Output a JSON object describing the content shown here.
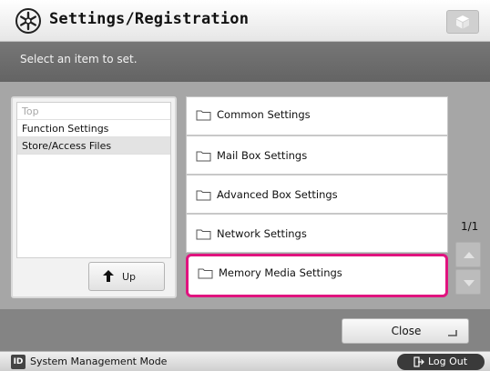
{
  "header": {
    "title": "Settings/Registration",
    "icon": "settings-gear-icon",
    "right_button_icon": "cube-icon"
  },
  "message": {
    "text": "Select an item to set."
  },
  "tree": {
    "items": [
      {
        "label": "Top"
      },
      {
        "label": "Function Settings"
      },
      {
        "label": "Store/Access Files",
        "selected": true
      }
    ],
    "up_label": "Up"
  },
  "list": {
    "items": [
      {
        "label": "Common Settings"
      },
      {
        "label": "Mail Box Settings"
      },
      {
        "label": "Advanced Box Settings"
      },
      {
        "label": "Network Settings"
      },
      {
        "label": "Memory Media Settings",
        "highlighted": true
      }
    ],
    "page_indicator": "1/1"
  },
  "footer": {
    "close_label": "Close"
  },
  "status": {
    "id_badge": "ID",
    "mode_text": "System Management Mode",
    "logout_label": "Log Out"
  },
  "colors": {
    "highlight": "#e0147f",
    "bar": "#6c6c6c",
    "content_bg": "#a6a6a6"
  }
}
